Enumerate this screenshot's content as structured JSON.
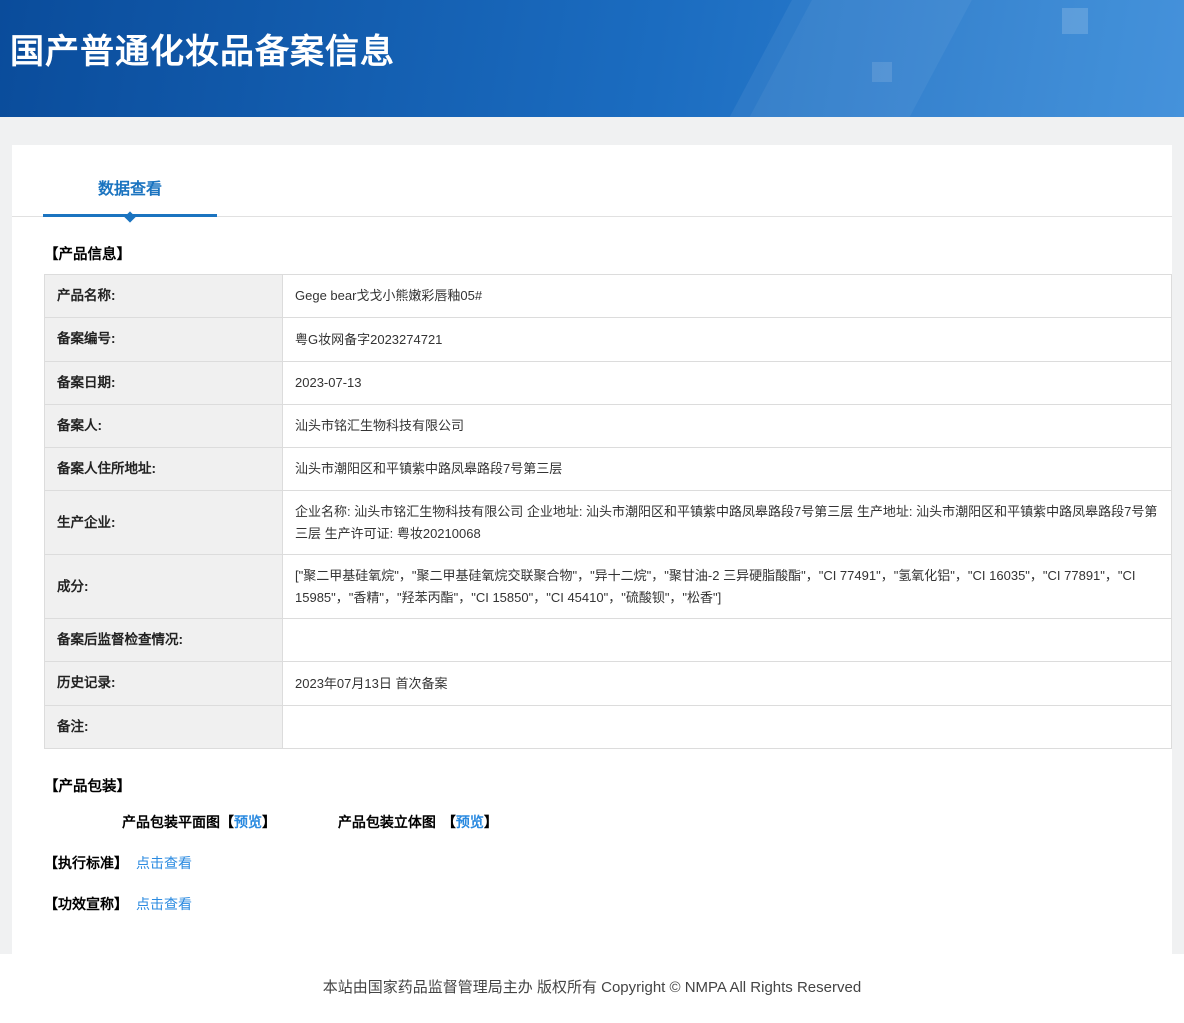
{
  "header": {
    "title": "国产普通化妆品备案信息"
  },
  "tab": {
    "label": "数据查看"
  },
  "sections": {
    "product_info": "【产品信息】",
    "packaging": "【产品包装】",
    "standard": "【执行标准】",
    "claims": "【功效宣称】"
  },
  "product_info": {
    "rows": [
      {
        "label": "产品名称:",
        "value": "Gege bear戈戈小熊嫩彩唇釉05#"
      },
      {
        "label": "备案编号:",
        "value": "粤G妆网备字2023274721"
      },
      {
        "label": "备案日期:",
        "value": "2023-07-13"
      },
      {
        "label": "备案人:",
        "value": "汕头市铭汇生物科技有限公司"
      },
      {
        "label": "备案人住所地址:",
        "value": "汕头市潮阳区和平镇紫中路凤皋路段7号第三层"
      },
      {
        "label": "生产企业:",
        "value": "企业名称: 汕头市铭汇生物科技有限公司 企业地址: 汕头市潮阳区和平镇紫中路凤皋路段7号第三层 生产地址: 汕头市潮阳区和平镇紫中路凤皋路段7号第三层 生产许可证: 粤妆20210068"
      },
      {
        "label": "成分:",
        "value": "[\"聚二甲基硅氧烷\"，\"聚二甲基硅氧烷交联聚合物\"，\"异十二烷\"，\"聚甘油-2 三异硬脂酸酯\"，\"CI 77491\"，\"氢氧化铝\"，\"CI 16035\"，\"CI 77891\"，\"CI 15985\"，\"香精\"，\"羟苯丙酯\"，\"CI 15850\"，\"CI 45410\"，\"硫酸钡\"，\"松香\"]"
      },
      {
        "label": "备案后监督检查情况:",
        "value": ""
      },
      {
        "label": "历史记录:",
        "value": "2023年07月13日 首次备案"
      },
      {
        "label": "备注:",
        "value": ""
      }
    ]
  },
  "packaging": {
    "bracket_open": "【",
    "bracket_close": "】",
    "items": [
      {
        "label": "产品包装平面图",
        "link": "预览"
      },
      {
        "label": "产品包装立体图",
        "link": "预览"
      }
    ]
  },
  "standard": {
    "link": "点击查看"
  },
  "claims": {
    "link": "点击查看"
  },
  "footer": {
    "text": "本站由国家药品监督管理局主办 版权所有 Copyright © NMPA All Rights Reserved"
  }
}
